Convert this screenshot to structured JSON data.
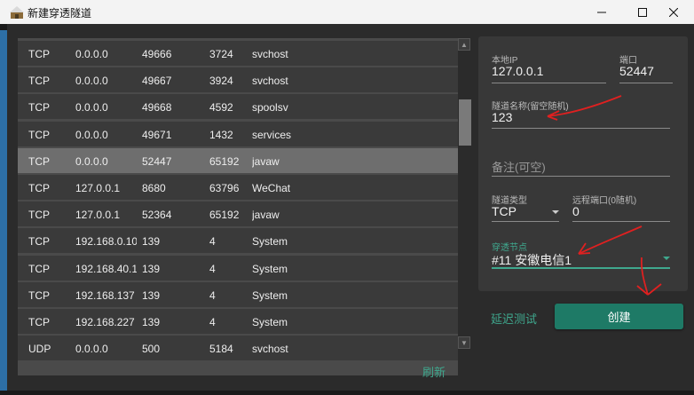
{
  "window": {
    "title": "新建穿透隧道"
  },
  "table": {
    "rows": [
      [
        "TCP",
        "0.0.0.0",
        "49666",
        "3724",
        "svchost"
      ],
      [
        "TCP",
        "0.0.0.0",
        "49667",
        "3924",
        "svchost"
      ],
      [
        "TCP",
        "0.0.0.0",
        "49668",
        "4592",
        "spoolsv"
      ],
      [
        "TCP",
        "0.0.0.0",
        "49671",
        "1432",
        "services"
      ],
      [
        "TCP",
        "0.0.0.0",
        "52447",
        "65192",
        "javaw"
      ],
      [
        "TCP",
        "127.0.0.1",
        "8680",
        "63796",
        "WeChat"
      ],
      [
        "TCP",
        "127.0.0.1",
        "52364",
        "65192",
        "javaw"
      ],
      [
        "TCP",
        "192.168.0.10",
        "139",
        "4",
        "System"
      ],
      [
        "TCP",
        "192.168.40.1",
        "139",
        "4",
        "System"
      ],
      [
        "TCP",
        "192.168.137",
        "139",
        "4",
        "System"
      ],
      [
        "TCP",
        "192.168.227",
        "139",
        "4",
        "System"
      ],
      [
        "UDP",
        "0.0.0.0",
        "500",
        "5184",
        "svchost"
      ]
    ],
    "selected_index": 4,
    "refresh_label": "刷新"
  },
  "form": {
    "local_ip_label": "本地IP",
    "local_ip_value": "127.0.0.1",
    "port_label": "端口",
    "port_value": "52447",
    "tunnel_name_label": "隧道名称(留空随机)",
    "tunnel_name_value": "123",
    "remark_placeholder": "备注(可空)",
    "tunnel_type_label": "隧道类型",
    "tunnel_type_value": "TCP",
    "remote_port_label": "远程端口(0随机)",
    "remote_port_value": "0",
    "node_label": "穿透节点",
    "node_value": "#11 安徽电信1"
  },
  "actions": {
    "latency_test": "延迟测试",
    "create": "创建"
  },
  "colors": {
    "accent": "#3fa88e",
    "button": "#1e7a66",
    "selected_row": "#6e6e6e",
    "annotation": "#e02020"
  }
}
